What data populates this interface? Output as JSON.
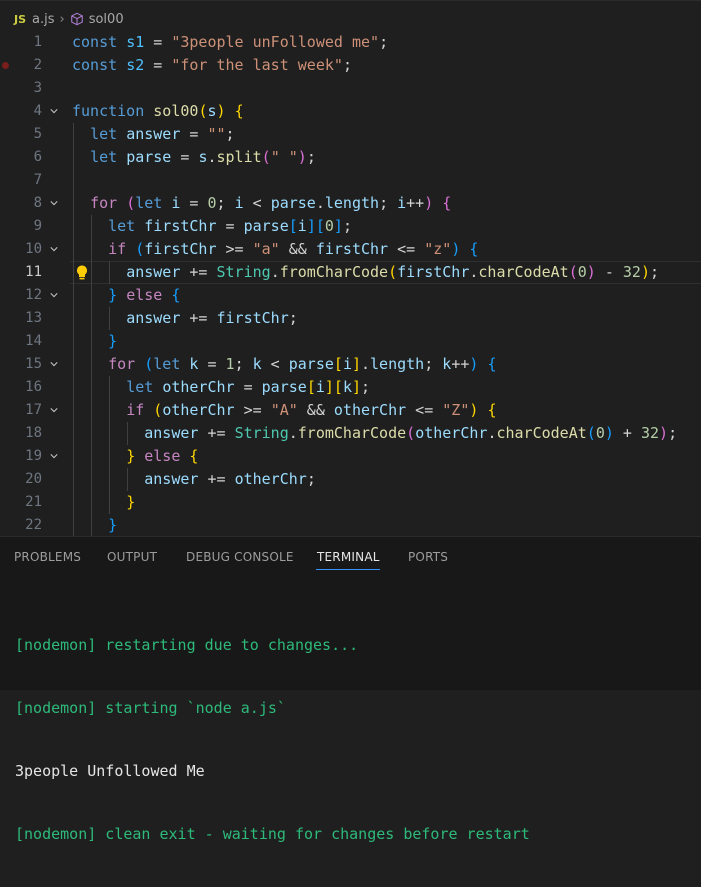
{
  "breadcrumb": {
    "file_icon": "JS",
    "file": "a.js",
    "symbol_icon": "cube-icon",
    "symbol": "sol00"
  },
  "editor": {
    "current_line": 11,
    "lines": [
      {
        "n": "1",
        "t": [
          [
            "kw",
            "const "
          ],
          [
            "const",
            "s1"
          ],
          [
            "op",
            " = "
          ],
          [
            "str",
            "\"3people unFollowed me\""
          ],
          [
            "op",
            ";"
          ]
        ]
      },
      {
        "n": "2",
        "t": [
          [
            "kw",
            "const "
          ],
          [
            "const",
            "s2"
          ],
          [
            "op",
            " = "
          ],
          [
            "str",
            "\"for the last week\""
          ],
          [
            "op",
            ";"
          ]
        ]
      },
      {
        "n": "3",
        "t": []
      },
      {
        "n": "4",
        "t": [
          [
            "kw",
            "function "
          ],
          [
            "fn",
            "sol00"
          ],
          [
            "b1",
            "("
          ],
          [
            "var",
            "s"
          ],
          [
            "b1",
            ")"
          ],
          [
            "op",
            " "
          ],
          [
            "b1",
            "{"
          ]
        ]
      },
      {
        "n": "5",
        "t": [
          [
            "op",
            "  "
          ],
          [
            "kw",
            "let "
          ],
          [
            "var",
            "answer"
          ],
          [
            "op",
            " = "
          ],
          [
            "str",
            "\"\""
          ],
          [
            "op",
            ";"
          ]
        ]
      },
      {
        "n": "6",
        "t": [
          [
            "op",
            "  "
          ],
          [
            "kw",
            "let "
          ],
          [
            "var",
            "parse"
          ],
          [
            "op",
            " = "
          ],
          [
            "var",
            "s"
          ],
          [
            "op",
            "."
          ],
          [
            "fn",
            "split"
          ],
          [
            "b2",
            "("
          ],
          [
            "str",
            "\" \""
          ],
          [
            "b2",
            ")"
          ],
          [
            "op",
            ";"
          ]
        ]
      },
      {
        "n": "7",
        "t": []
      },
      {
        "n": "8",
        "t": [
          [
            "op",
            "  "
          ],
          [
            "ctl",
            "for"
          ],
          [
            "op",
            " "
          ],
          [
            "b2",
            "("
          ],
          [
            "kw",
            "let "
          ],
          [
            "var",
            "i"
          ],
          [
            "op",
            " = "
          ],
          [
            "num",
            "0"
          ],
          [
            "op",
            "; "
          ],
          [
            "var",
            "i"
          ],
          [
            "op",
            " < "
          ],
          [
            "var",
            "parse"
          ],
          [
            "op",
            "."
          ],
          [
            "var",
            "length"
          ],
          [
            "op",
            "; "
          ],
          [
            "var",
            "i"
          ],
          [
            "op",
            "++"
          ],
          [
            "b2",
            ")"
          ],
          [
            "op",
            " "
          ],
          [
            "b2",
            "{"
          ]
        ]
      },
      {
        "n": "9",
        "t": [
          [
            "op",
            "    "
          ],
          [
            "kw",
            "let "
          ],
          [
            "var",
            "firstChr"
          ],
          [
            "op",
            " = "
          ],
          [
            "var",
            "parse"
          ],
          [
            "b3",
            "["
          ],
          [
            "var",
            "i"
          ],
          [
            "b3",
            "]"
          ],
          [
            "b3",
            "["
          ],
          [
            "num",
            "0"
          ],
          [
            "b3",
            "]"
          ],
          [
            "op",
            ";"
          ]
        ]
      },
      {
        "n": "10",
        "t": [
          [
            "op",
            "    "
          ],
          [
            "ctl",
            "if"
          ],
          [
            "op",
            " "
          ],
          [
            "b3",
            "("
          ],
          [
            "var",
            "firstChr"
          ],
          [
            "op",
            " >= "
          ],
          [
            "str",
            "\"a\""
          ],
          [
            "op",
            " && "
          ],
          [
            "var",
            "firstChr"
          ],
          [
            "op",
            " <= "
          ],
          [
            "str",
            "\"z\""
          ],
          [
            "b3",
            ")"
          ],
          [
            "op",
            " "
          ],
          [
            "b3",
            "{"
          ]
        ]
      },
      {
        "n": "11",
        "t": [
          [
            "op",
            "      "
          ],
          [
            "var",
            "answer"
          ],
          [
            "op",
            " += "
          ],
          [
            "cls",
            "String"
          ],
          [
            "op",
            "."
          ],
          [
            "fn",
            "fromCharCode"
          ],
          [
            "b1",
            "("
          ],
          [
            "var",
            "firstChr"
          ],
          [
            "op",
            "."
          ],
          [
            "fn",
            "charCodeAt"
          ],
          [
            "b2",
            "("
          ],
          [
            "num",
            "0"
          ],
          [
            "b2",
            ")"
          ],
          [
            "op",
            " - "
          ],
          [
            "num",
            "32"
          ],
          [
            "b1",
            ")"
          ],
          [
            "op",
            ";"
          ]
        ]
      },
      {
        "n": "12",
        "t": [
          [
            "op",
            "    "
          ],
          [
            "b3",
            "}"
          ],
          [
            "op",
            " "
          ],
          [
            "ctl",
            "else"
          ],
          [
            "op",
            " "
          ],
          [
            "b3",
            "{"
          ]
        ]
      },
      {
        "n": "13",
        "t": [
          [
            "op",
            "      "
          ],
          [
            "var",
            "answer"
          ],
          [
            "op",
            " += "
          ],
          [
            "var",
            "firstChr"
          ],
          [
            "op",
            ";"
          ]
        ]
      },
      {
        "n": "14",
        "t": [
          [
            "op",
            "    "
          ],
          [
            "b3",
            "}"
          ]
        ]
      },
      {
        "n": "15",
        "t": [
          [
            "op",
            "    "
          ],
          [
            "ctl",
            "for"
          ],
          [
            "op",
            " "
          ],
          [
            "b3",
            "("
          ],
          [
            "kw",
            "let "
          ],
          [
            "var",
            "k"
          ],
          [
            "op",
            " = "
          ],
          [
            "num",
            "1"
          ],
          [
            "op",
            "; "
          ],
          [
            "var",
            "k"
          ],
          [
            "op",
            " < "
          ],
          [
            "var",
            "parse"
          ],
          [
            "b1",
            "["
          ],
          [
            "var",
            "i"
          ],
          [
            "b1",
            "]"
          ],
          [
            "op",
            "."
          ],
          [
            "var",
            "length"
          ],
          [
            "op",
            "; "
          ],
          [
            "var",
            "k"
          ],
          [
            "op",
            "++"
          ],
          [
            "b3",
            ")"
          ],
          [
            "op",
            " "
          ],
          [
            "b3",
            "{"
          ]
        ]
      },
      {
        "n": "16",
        "t": [
          [
            "op",
            "      "
          ],
          [
            "kw",
            "let "
          ],
          [
            "var",
            "otherChr"
          ],
          [
            "op",
            " = "
          ],
          [
            "var",
            "parse"
          ],
          [
            "b1",
            "["
          ],
          [
            "var",
            "i"
          ],
          [
            "b1",
            "]"
          ],
          [
            "b1",
            "["
          ],
          [
            "var",
            "k"
          ],
          [
            "b1",
            "]"
          ],
          [
            "op",
            ";"
          ]
        ]
      },
      {
        "n": "17",
        "t": [
          [
            "op",
            "      "
          ],
          [
            "ctl",
            "if"
          ],
          [
            "op",
            " "
          ],
          [
            "b1",
            "("
          ],
          [
            "var",
            "otherChr"
          ],
          [
            "op",
            " >= "
          ],
          [
            "str",
            "\"A\""
          ],
          [
            "op",
            " && "
          ],
          [
            "var",
            "otherChr"
          ],
          [
            "op",
            " <= "
          ],
          [
            "str",
            "\"Z\""
          ],
          [
            "b1",
            ")"
          ],
          [
            "op",
            " "
          ],
          [
            "b1",
            "{"
          ]
        ]
      },
      {
        "n": "18",
        "t": [
          [
            "op",
            "        "
          ],
          [
            "var",
            "answer"
          ],
          [
            "op",
            " += "
          ],
          [
            "cls",
            "String"
          ],
          [
            "op",
            "."
          ],
          [
            "fn",
            "fromCharCode"
          ],
          [
            "b2",
            "("
          ],
          [
            "var",
            "otherChr"
          ],
          [
            "op",
            "."
          ],
          [
            "fn",
            "charCodeAt"
          ],
          [
            "b3",
            "("
          ],
          [
            "num",
            "0"
          ],
          [
            "b3",
            ")"
          ],
          [
            "op",
            " + "
          ],
          [
            "num",
            "32"
          ],
          [
            "b2",
            ")"
          ],
          [
            "op",
            ";"
          ]
        ]
      },
      {
        "n": "19",
        "t": [
          [
            "op",
            "      "
          ],
          [
            "b1",
            "}"
          ],
          [
            "op",
            " "
          ],
          [
            "ctl",
            "else"
          ],
          [
            "op",
            " "
          ],
          [
            "b1",
            "{"
          ]
        ]
      },
      {
        "n": "20",
        "t": [
          [
            "op",
            "        "
          ],
          [
            "var",
            "answer"
          ],
          [
            "op",
            " += "
          ],
          [
            "var",
            "otherChr"
          ],
          [
            "op",
            ";"
          ]
        ]
      },
      {
        "n": "21",
        "t": [
          [
            "op",
            "      "
          ],
          [
            "b1",
            "}"
          ]
        ]
      },
      {
        "n": "22",
        "t": [
          [
            "op",
            "    "
          ],
          [
            "b3",
            "}"
          ]
        ]
      }
    ]
  },
  "panel": {
    "tabs": [
      "PROBLEMS",
      "OUTPUT",
      "DEBUG CONSOLE",
      "TERMINAL",
      "PORTS"
    ],
    "active_tab": "TERMINAL",
    "terminal_lines": [
      {
        "style": "green",
        "text": "[nodemon] restarting due to changes..."
      },
      {
        "style": "green",
        "text": "[nodemon] starting `node a.js`"
      },
      {
        "style": "white",
        "text": "3people Unfollowed Me"
      },
      {
        "style": "green",
        "text": "[nodemon] clean exit - waiting for changes before restart"
      }
    ]
  },
  "colors": {
    "background": "#1f1f1f",
    "keyword": "#569cd6",
    "string": "#ce9178",
    "terminal_green": "#2dba7a",
    "active_tab_underline": "#3794ff"
  }
}
